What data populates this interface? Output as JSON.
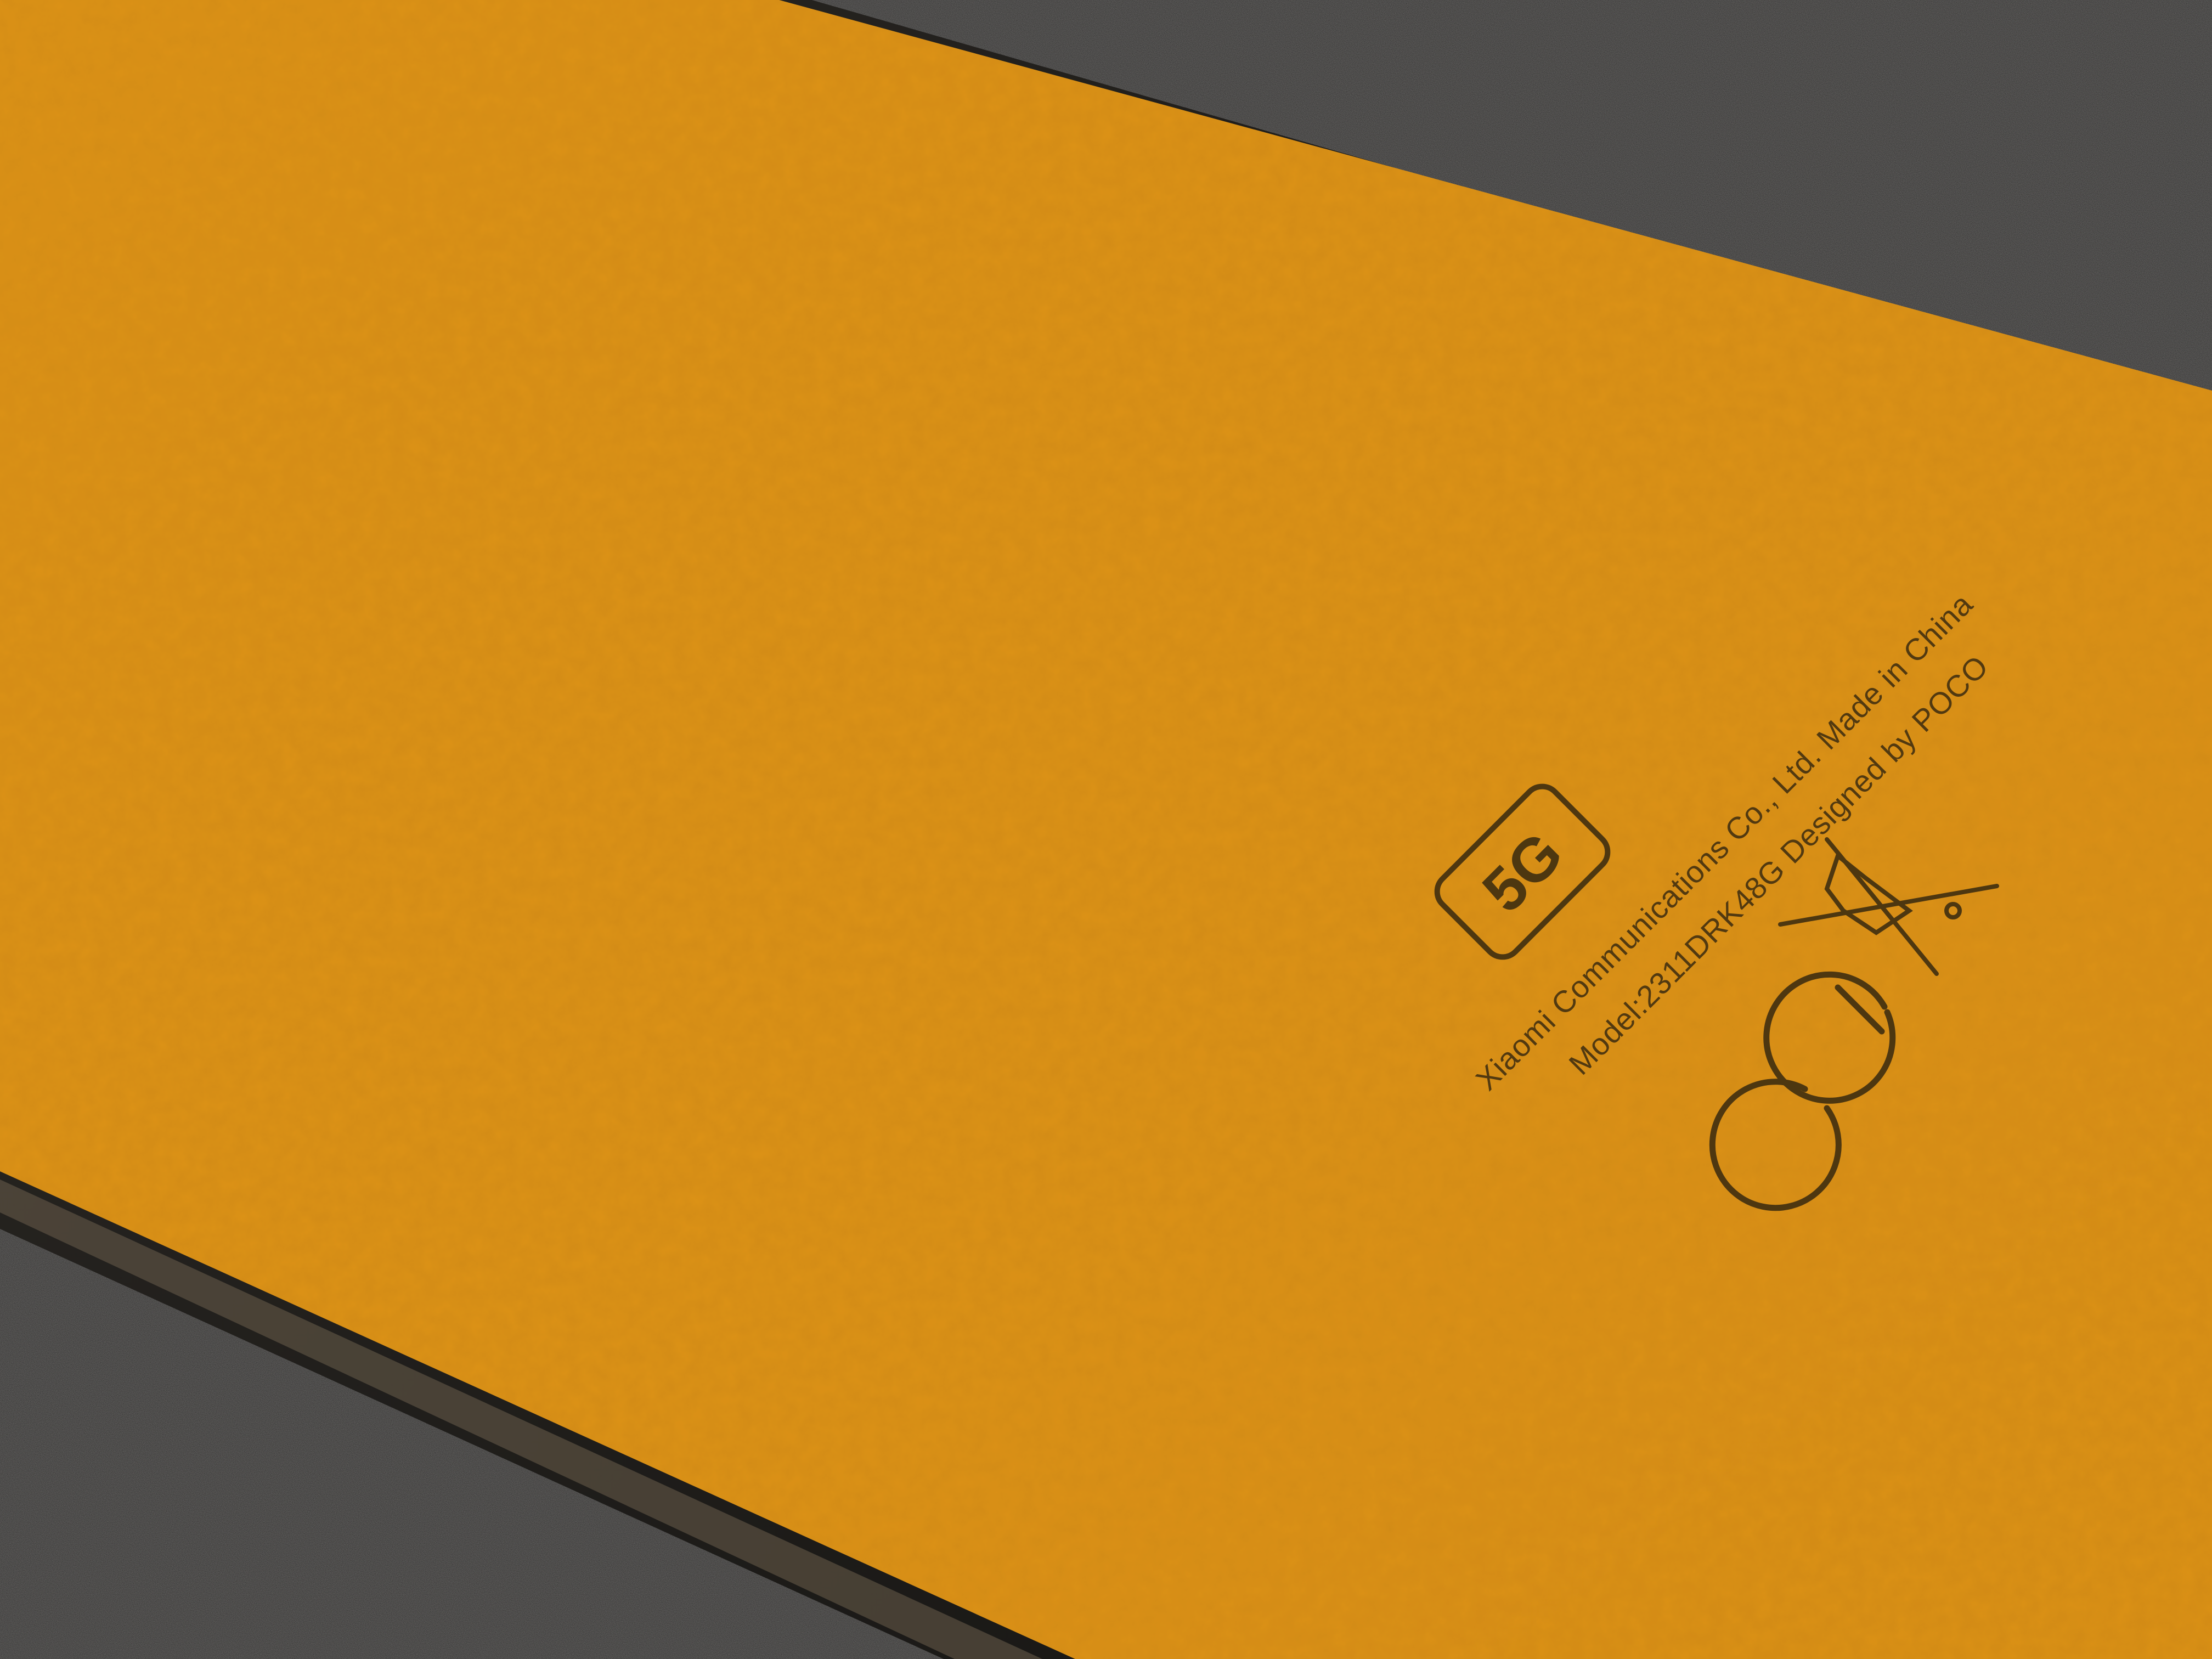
{
  "scene": {
    "description_colors": {
      "leather": "#dc9218",
      "leather_edge": "#c98413",
      "background_felt": "#262524",
      "frame": "#1c1a17",
      "engraving": "#3f2e10"
    }
  },
  "engraving": {
    "network_badge": "5G",
    "manufacturer_line": "Xiaomi Communications Co., Ltd.  Made in China",
    "model_line": "Model:2311DRK48G   Designed by POCO",
    "ce_mark_icon": "ce-mark-icon",
    "weee_icon": "crossed-out-bin-icon"
  }
}
